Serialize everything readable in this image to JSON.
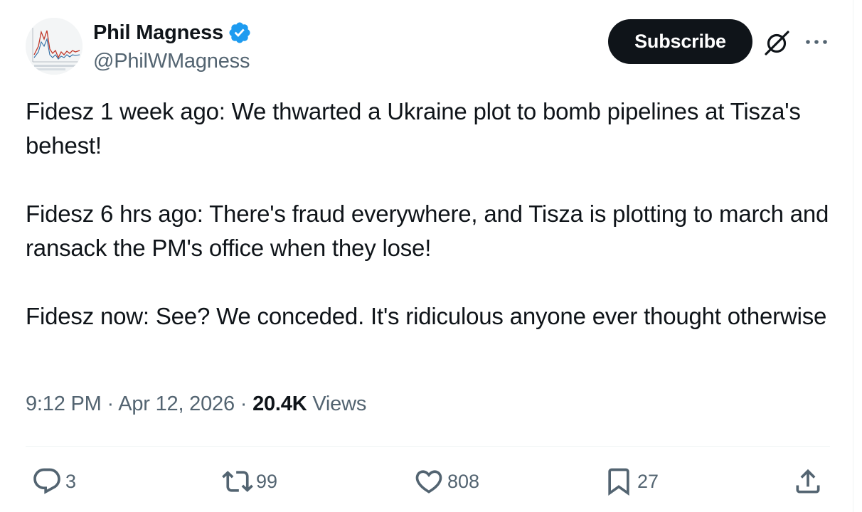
{
  "author": {
    "display_name": "Phil Magness",
    "handle": "@PhilWMagness",
    "verified_icon": "verified-badge-icon",
    "accent_color": "#1d9bf0"
  },
  "header": {
    "subscribe_label": "Subscribe",
    "grok_icon": "grok-icon",
    "more_icon": "more-options-icon"
  },
  "tweet": {
    "paragraphs": [
      "Fidesz 1 week ago: We thwarted a Ukraine plot to bomb pipelines at Tisza's behest!",
      "Fidesz 6 hrs ago: There's fraud everywhere, and Tisza is plotting to march and ransack the PM's office when they lose!",
      "Fidesz now: See? We conceded. It's ridiculous anyone ever thought otherwise"
    ],
    "time": "9:12 PM",
    "date": "Apr 12, 2026",
    "separator": "·",
    "views_count": "20.4K",
    "views_label": "Views"
  },
  "actions": {
    "replies": "3",
    "reposts": "99",
    "likes": "808",
    "bookmarks": "27"
  }
}
